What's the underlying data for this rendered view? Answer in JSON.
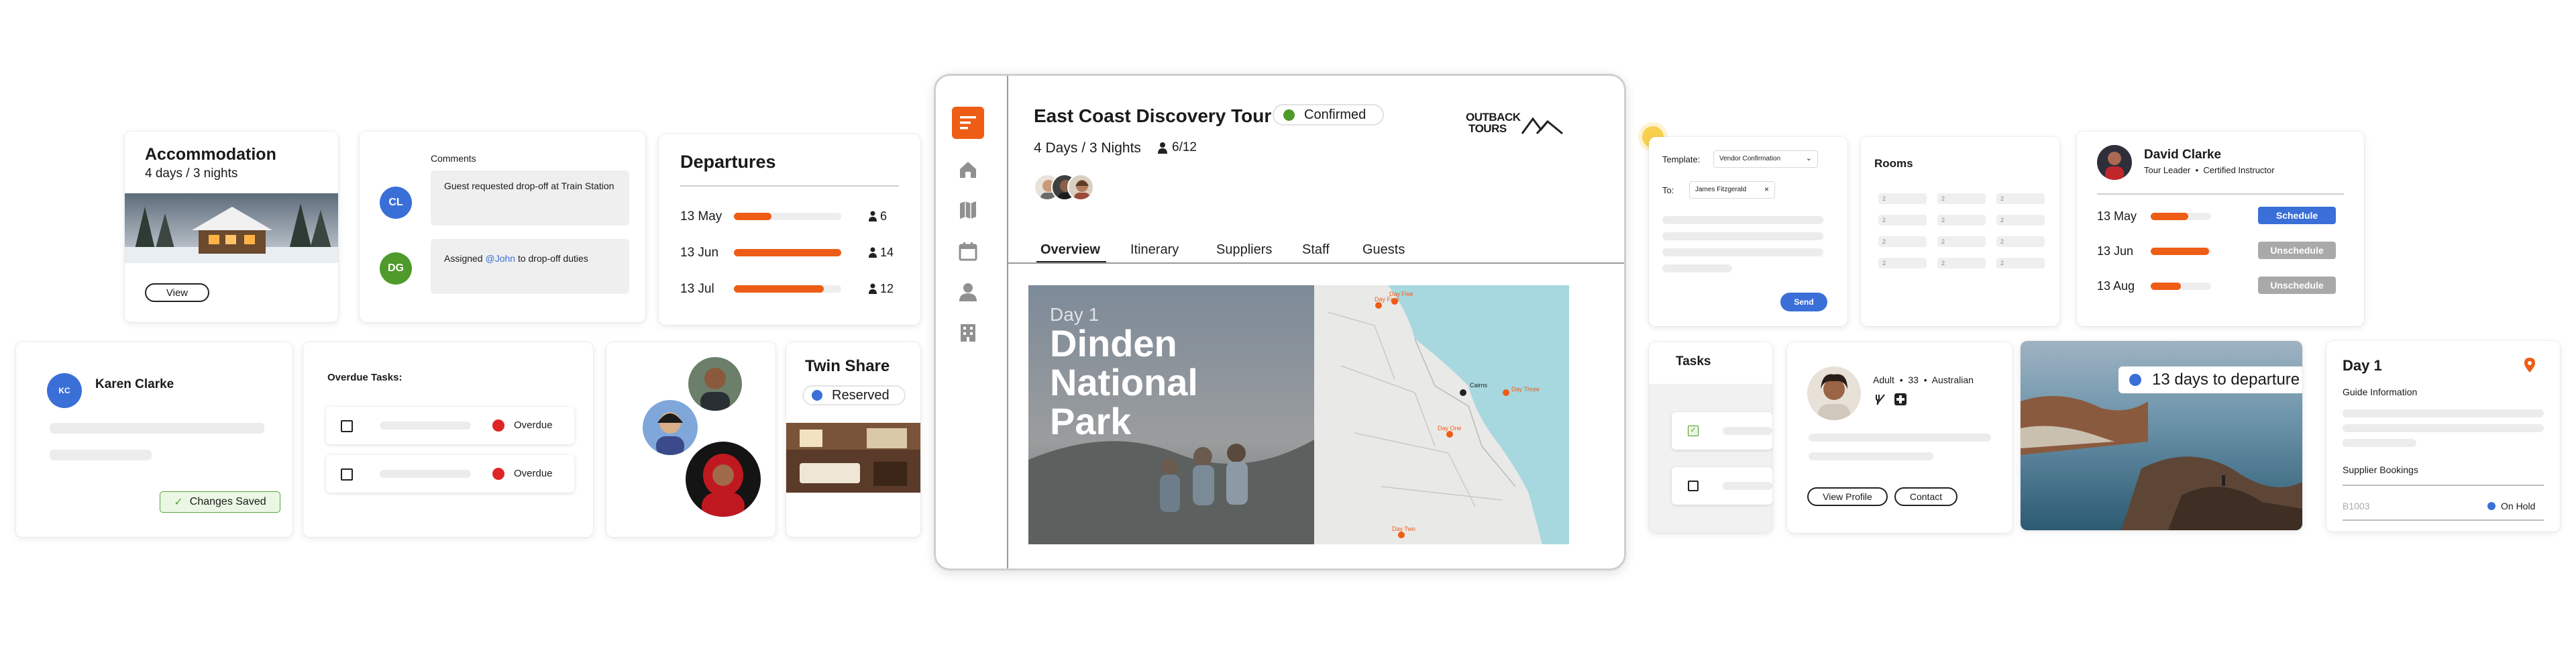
{
  "accommodation": {
    "title": "Accommodation",
    "subtitle": "4 days / 3 nights",
    "view_label": "View"
  },
  "comments": {
    "title": "Comments",
    "items": [
      {
        "initials": "CL",
        "color": "#3a6fd8",
        "text": "Guest requested drop-off at Train Station"
      },
      {
        "initials": "DG",
        "color": "#4e9a2a",
        "text_before": "Assigned ",
        "mention": "@John",
        "text_after": " to drop-off duties"
      }
    ]
  },
  "departures": {
    "title": "Departures",
    "rows": [
      {
        "date": "13 May",
        "fill": 0.35,
        "count": "6"
      },
      {
        "date": "13 Jun",
        "fill": 1.0,
        "count": "14"
      },
      {
        "date": "13 Jul",
        "fill": 0.84,
        "count": "12"
      }
    ]
  },
  "karen": {
    "initials": "KC",
    "name": "Karen Clarke",
    "saved_label": "Changes Saved"
  },
  "overdue": {
    "title": "Overdue Tasks:",
    "items": [
      {
        "status": "Overdue"
      },
      {
        "status": "Overdue"
      }
    ]
  },
  "twin_share": {
    "title": "Twin Share",
    "status": "Reserved"
  },
  "tour": {
    "title": "East Coast Discovery Tour",
    "status": "Confirmed",
    "duration": "4 Days / 3 Nights",
    "capacity": "6/12",
    "brand_line1": "OUTBACK",
    "brand_line2": "TOURS",
    "tabs": [
      "Overview",
      "Itinerary",
      "Suppliers",
      "Staff",
      "Guests"
    ],
    "day_label": "Day 1",
    "place_line1": "Dinden",
    "place_line2": "National",
    "place_line3": "Park",
    "map_labels": [
      "Day Four",
      "Day Five",
      "Cairns",
      "Day Three",
      "Day One",
      "Day Two"
    ]
  },
  "vendor": {
    "template_label": "Template:",
    "template_value": "Vendor Confirmation",
    "to_label": "To:",
    "recipient": "James Fitzgerald",
    "send_label": "Send"
  },
  "rooms": {
    "title": "Rooms",
    "cells": [
      "2",
      "2",
      "2",
      "2",
      "2",
      "2",
      "2",
      "2",
      "2",
      "2",
      "2",
      "2"
    ]
  },
  "david": {
    "name": "David Clarke",
    "role_1": "Tour Leader",
    "role_2": "Certified Instructor",
    "rows": [
      {
        "date": "13 May",
        "fill": 0.62,
        "action": "Schedule",
        "color": "#3a6fd8"
      },
      {
        "date": "13 Jun",
        "fill": 0.97,
        "action": "Unschedule",
        "color": "#a9a9a9"
      },
      {
        "date": "13 Aug",
        "fill": 0.5,
        "action": "Unschedule",
        "color": "#a9a9a9"
      }
    ]
  },
  "tasks": {
    "title": "Tasks"
  },
  "guest": {
    "type": "Adult",
    "age": "33",
    "nationality": "Australian",
    "view_label": "View Profile",
    "contact_label": "Contact"
  },
  "countdown": {
    "text": "13 days to departure"
  },
  "day_card": {
    "title": "Day 1",
    "guide_label": "Guide Information",
    "supplier_label": "Supplier Bookings",
    "booking_id": "B1003",
    "booking_status": "On Hold"
  },
  "colors": {
    "accent": "#ee5d15",
    "blue": "#3a6fd8",
    "green": "#4e9a2a",
    "red": "#e02424"
  }
}
